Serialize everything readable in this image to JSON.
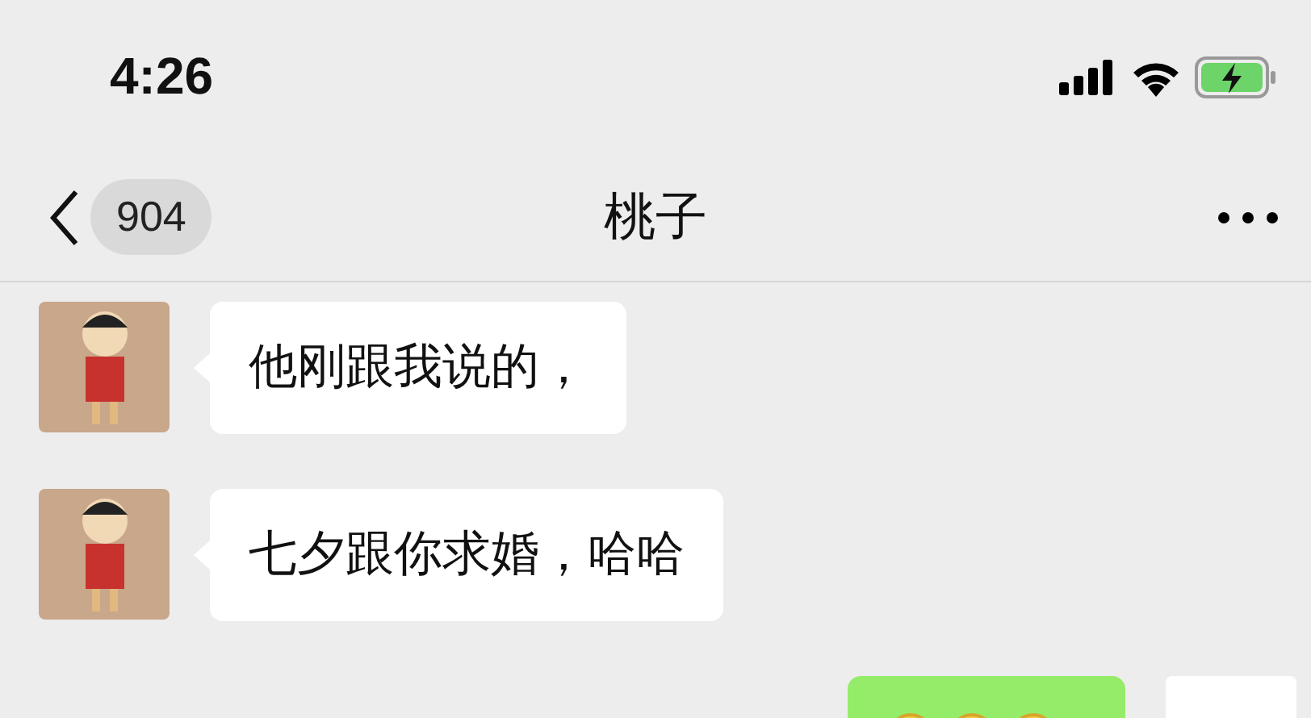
{
  "status_bar": {
    "time": "4:26",
    "charging": true
  },
  "nav": {
    "unread": "904",
    "title": "桃子"
  },
  "messages": [
    {
      "kind": "received",
      "text": "他刚跟我说的，"
    },
    {
      "kind": "received",
      "text": "七夕跟你求婚，哈哈"
    },
    {
      "kind": "sent-emoji"
    }
  ]
}
